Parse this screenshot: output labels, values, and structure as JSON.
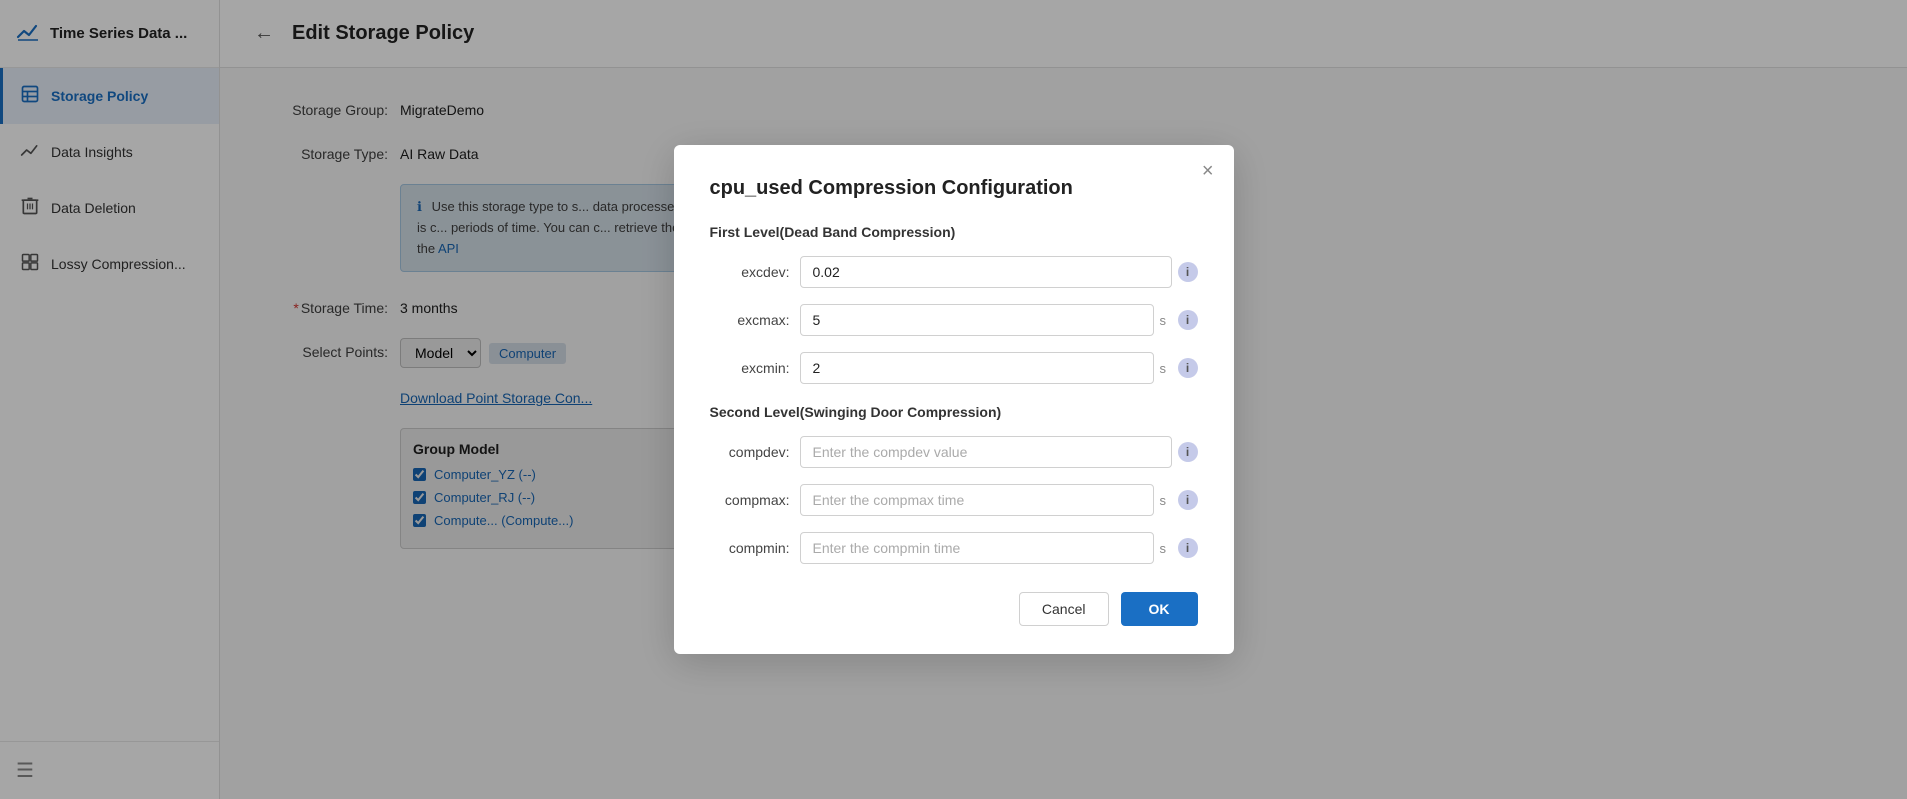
{
  "sidebar": {
    "title": "Time Series Data ...",
    "items": [
      {
        "id": "time-series",
        "label": "Time Series Data",
        "icon": "chart"
      },
      {
        "id": "storage-policy",
        "label": "Storage Policy",
        "icon": "storage",
        "active": true
      },
      {
        "id": "data-insights",
        "label": "Data Insights",
        "icon": "insights"
      },
      {
        "id": "data-deletion",
        "label": "Data Deletion",
        "icon": "deletion"
      },
      {
        "id": "lossy-compression",
        "label": "Lossy Compression...",
        "icon": "compression"
      }
    ],
    "bottom_icon": "menu"
  },
  "main": {
    "back_label": "←",
    "title": "Edit Storage Policy",
    "storage_group_label": "Storage Group:",
    "storage_group_value": "MigrateDemo",
    "storage_type_label": "Storage Type:",
    "storage_type_value": "AI Raw Data",
    "info_text": "Use this storage type to s... data processed by the str... frequency, AI raw data is c... periods of time. You can c... retrieve the stored data o... information, view the API",
    "api_link": "API",
    "storage_time_label": "* Storage Time:",
    "storage_time_value": "3 months",
    "select_points_label": "Select Points:",
    "model_placeholder": "Model",
    "computer_placeholder": "Computer",
    "download_link": "Download Point Storage Con...",
    "group_model_title": "Group Model",
    "checkboxes": [
      {
        "label": "Computer_YZ (--)",
        "checked": true
      },
      {
        "label": "Computer_RJ (--)",
        "checked": true
      },
      {
        "label": "Compute... (Compute...)",
        "checked": true
      }
    ]
  },
  "dialog": {
    "title": "cpu_used Compression Configuration",
    "close_label": "×",
    "first_level_title": "First Level(Dead Band Compression)",
    "fields_first": [
      {
        "id": "excdev",
        "label": "excdev:",
        "value": "0.02",
        "placeholder": "",
        "unit": "",
        "has_unit": false
      },
      {
        "id": "excmax",
        "label": "excmax:",
        "value": "5",
        "placeholder": "",
        "unit": "s",
        "has_unit": true
      },
      {
        "id": "excmin",
        "label": "excmin:",
        "value": "2",
        "placeholder": "",
        "unit": "s",
        "has_unit": true
      }
    ],
    "second_level_title": "Second Level(Swinging Door Compression)",
    "fields_second": [
      {
        "id": "compdev",
        "label": "compdev:",
        "value": "",
        "placeholder": "Enter the compdev value",
        "unit": "",
        "has_unit": false
      },
      {
        "id": "compmax",
        "label": "compmax:",
        "value": "",
        "placeholder": "Enter the compmax time",
        "unit": "s",
        "has_unit": true
      },
      {
        "id": "compmin",
        "label": "compmin:",
        "value": "",
        "placeholder": "Enter the compmin time",
        "unit": "s",
        "has_unit": true
      }
    ],
    "cancel_label": "Cancel",
    "ok_label": "OK"
  }
}
